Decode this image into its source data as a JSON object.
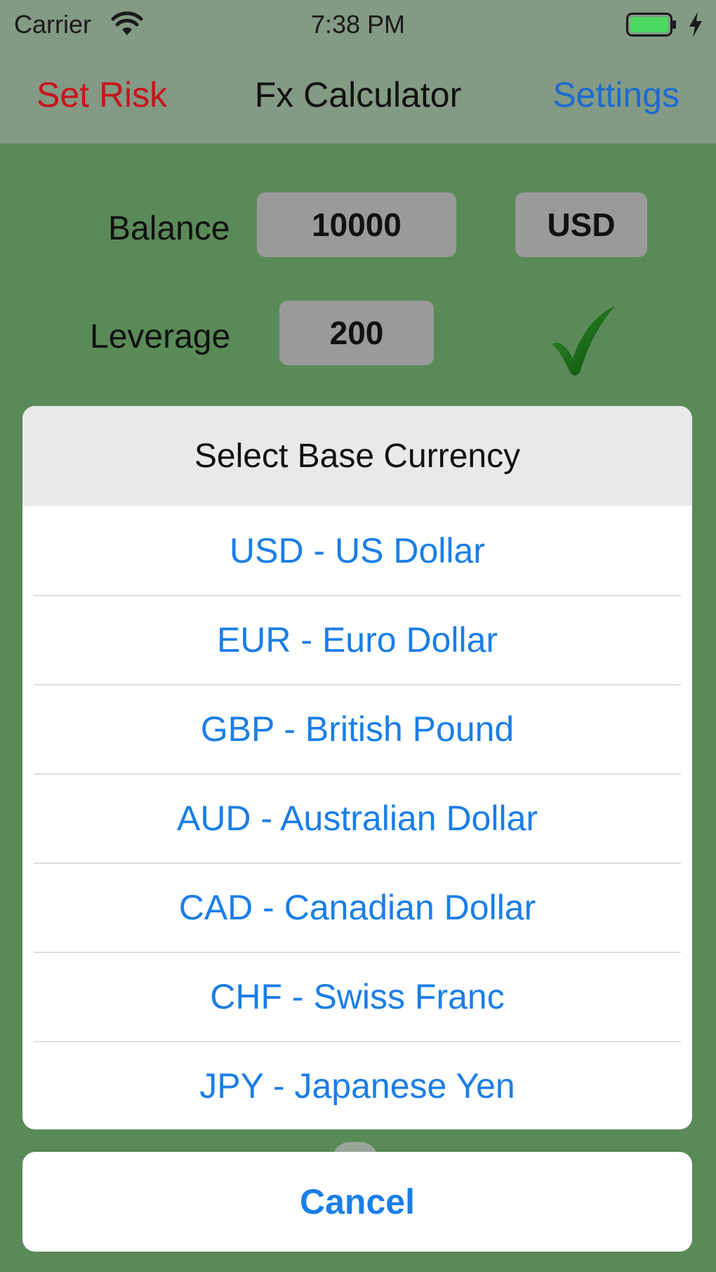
{
  "status_bar": {
    "carrier": "Carrier",
    "time": "7:38 PM",
    "battery_color": "#4cd964"
  },
  "nav": {
    "left_label": "Set Risk",
    "title": "Fx Calculator",
    "right_label": "Settings",
    "left_color": "#c8141c",
    "right_color": "#1d6bd1"
  },
  "form": {
    "balance_label": "Balance",
    "balance_value": "10000",
    "currency_value": "USD",
    "leverage_label": "Leverage",
    "leverage_value": "200",
    "confirm_icon": "checkmark-icon"
  },
  "sheet": {
    "title": "Select Base Currency",
    "options": [
      "USD - US Dollar",
      "EUR - Euro Dollar",
      "GBP - British Pound",
      "AUD - Australian Dollar",
      "CAD - Canadian Dollar",
      "CHF - Swiss Franc",
      "JPY - Japanese Yen"
    ],
    "cancel_label": "Cancel",
    "accent_color": "#1a7ee6"
  },
  "colors": {
    "background": "#5a8a58",
    "navbar": "#839a84",
    "field": "#9a9a9a"
  }
}
